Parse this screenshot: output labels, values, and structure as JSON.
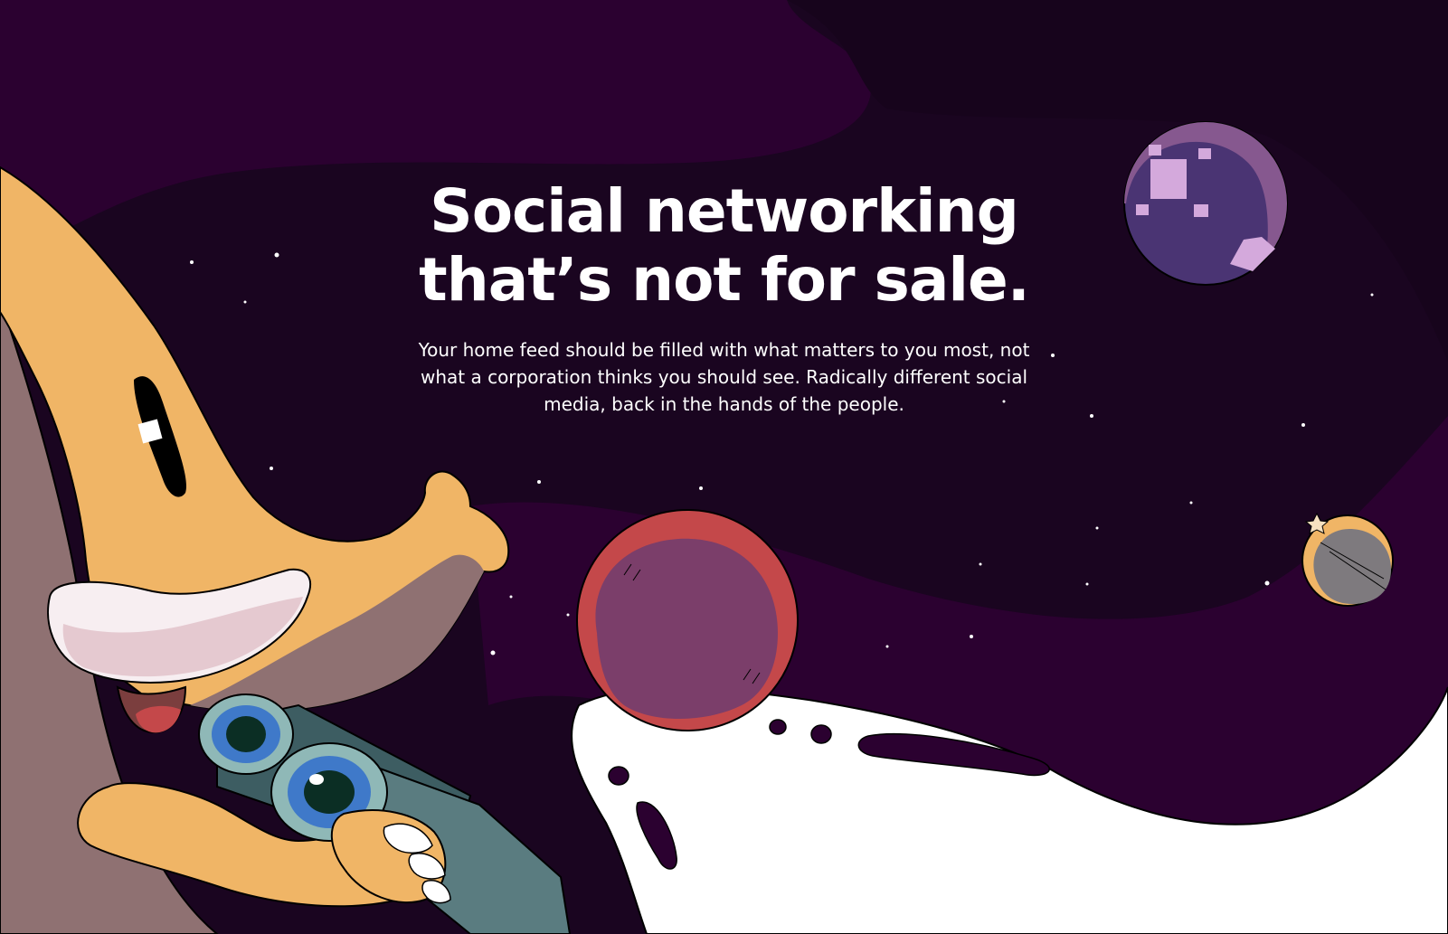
{
  "hero": {
    "title_line1": "Social networking",
    "title_line2": "that’s not for sale.",
    "subtitle": "Your home feed should be filled with what matters to you most, not what a corporation thinks you should see. Radically different social media, back in the hands of the people."
  },
  "colors": {
    "space_dark": "#17041c",
    "space_purple": "#2b0130",
    "mascot_body": "#f0b566",
    "mascot_shadow": "#8f7172",
    "binoculars": "#5a7c80",
    "moon_white": "#ffffff",
    "planet_violet": "#4a3473",
    "planet_red": "#c4484a",
    "planet_plum": "#7b3e6a"
  },
  "illustration": {
    "mascot": "mastodon-mascot-with-binoculars",
    "planets": [
      "violet-planet",
      "red-planet",
      "small-orange-planet"
    ]
  }
}
